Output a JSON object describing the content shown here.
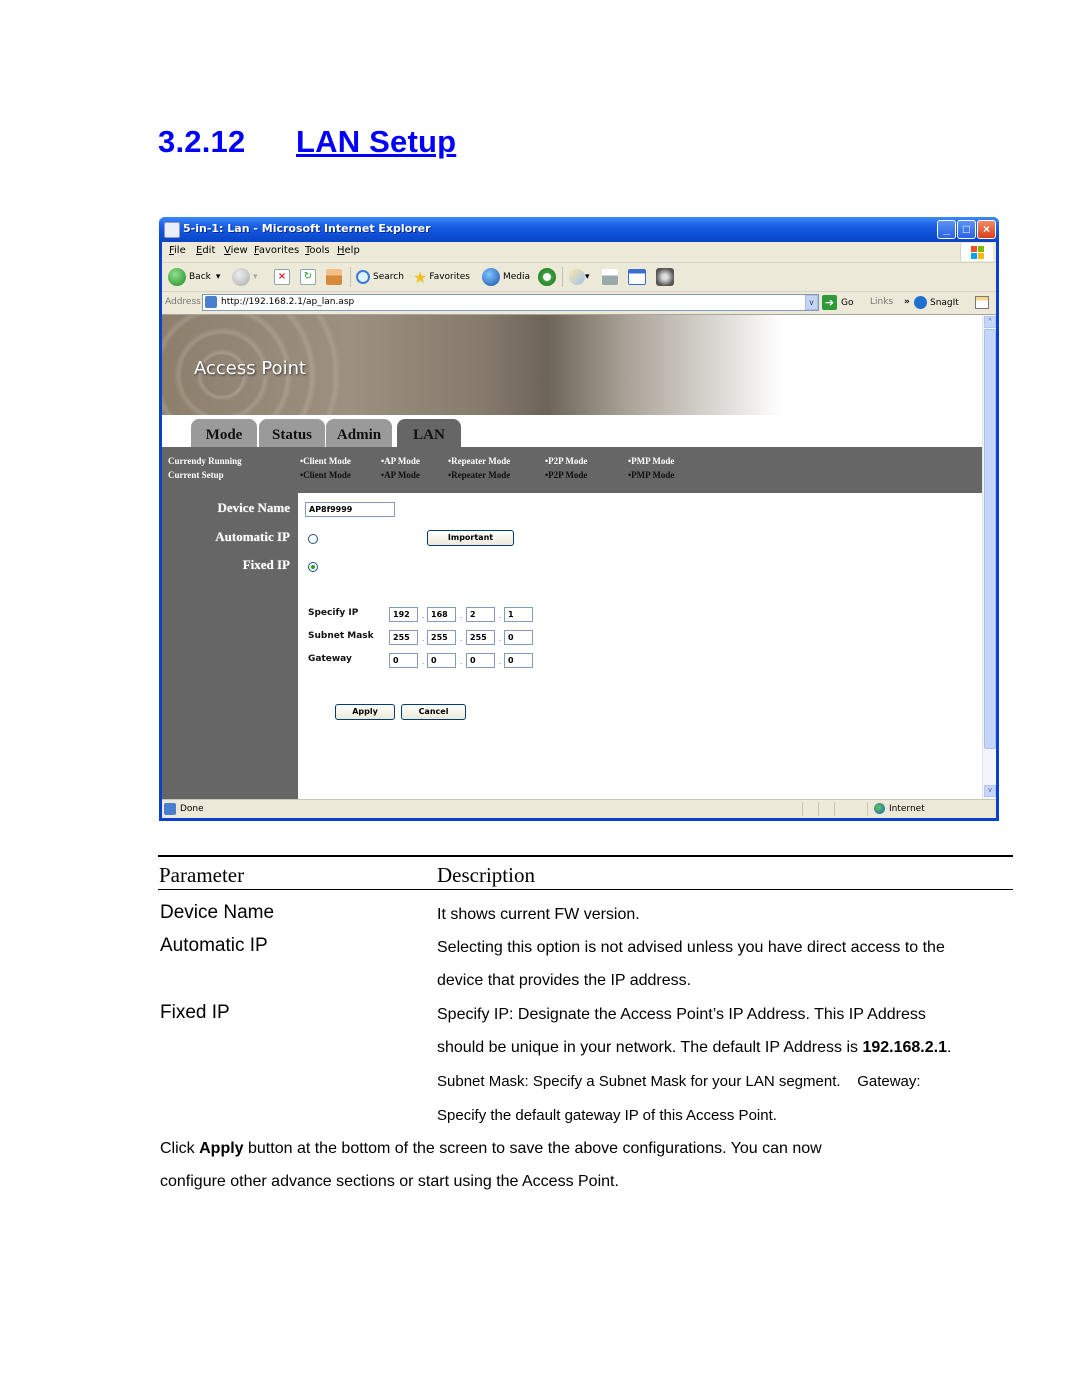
{
  "heading": {
    "number": "3.2.12",
    "title": "LAN Setup"
  },
  "browser": {
    "window_title": "5-in-1: Lan - Microsoft Internet Explorer",
    "window_buttons": {
      "minimize": "_",
      "maximize": "□",
      "close": "×"
    },
    "menu": [
      "File",
      "Edit",
      "View",
      "Favorites",
      "Tools",
      "Help"
    ],
    "toolbar": {
      "back": "Back",
      "search": "Search",
      "favorites": "Favorites",
      "media": "Media",
      "dropdown_glyph": "▾"
    },
    "address": {
      "label": "Address",
      "url": "http://192.168.2.1/ap_lan.asp",
      "go": "Go",
      "go_glyph": "➔",
      "links": "Links",
      "links_chevron": "»",
      "snagit": "SnagIt",
      "dropdown_glyph": "v"
    },
    "status": {
      "text": "Done",
      "zone": "Internet"
    },
    "scroll": {
      "up": "^",
      "down": "v"
    }
  },
  "page": {
    "banner_title": "Access Point",
    "tabs": [
      {
        "label": "Mode",
        "active": false
      },
      {
        "label": "Status",
        "active": false
      },
      {
        "label": "Admin",
        "active": false
      },
      {
        "label": "LAN",
        "active": true
      }
    ],
    "mode_rows": [
      {
        "label": "Currendy Running",
        "modes": [
          "•Client Mode",
          "•AP Mode",
          "•Repeater Mode",
          "•P2P Mode",
          "•PMP Mode"
        ]
      },
      {
        "label": "Current Setup",
        "modes": [
          "•Client Mode",
          "•AP Mode",
          "•Repeater Mode",
          "•P2P Mode",
          "•PMP Mode"
        ]
      }
    ],
    "fields": {
      "device_name_label": "Device Name",
      "device_name_value": "AP8f9999",
      "automatic_ip_label": "Automatic IP",
      "automatic_ip_selected": false,
      "important_button": "Important",
      "fixed_ip_label": "Fixed IP",
      "fixed_ip_selected": true
    },
    "ip_rows": [
      {
        "label": "Specify IP",
        "octets": [
          "192",
          "168",
          "2",
          "1"
        ]
      },
      {
        "label": "Subnet Mask",
        "octets": [
          "255",
          "255",
          "255",
          "0"
        ]
      },
      {
        "label": "Gateway",
        "octets": [
          "0",
          "0",
          "0",
          "0"
        ]
      }
    ],
    "ip_separator": ".",
    "apply_button": "Apply",
    "cancel_button": "Cancel"
  },
  "table": {
    "headers": {
      "parameter": "Parameter",
      "description": "Description"
    },
    "rows": [
      {
        "parameter": "Device Name",
        "lines": [
          "It shows current FW version."
        ]
      },
      {
        "parameter": "Automatic IP",
        "lines": [
          "Selecting this option is not advised unless you have direct access to the",
          "device that provides the IP address."
        ]
      },
      {
        "parameter": "Fixed IP",
        "lines": [
          "Specify IP: Designate the Access Point’s IP Address. This IP Address",
          "should be unique in your network. The default IP Address is ",
          "Subnet Mask: Specify a Subnet Mask for your LAN segment.    Gateway:",
          "Specify the default gateway IP of this Access Point."
        ],
        "default_ip": "192.168.2.1",
        "default_ip_suffix": "."
      }
    ]
  },
  "footer": {
    "prefix": "Click ",
    "bold": "Apply",
    "rest": " button at the bottom of the screen to save the above configurations. You can now",
    "line2": "configure other advance sections or start using the Access Point."
  }
}
